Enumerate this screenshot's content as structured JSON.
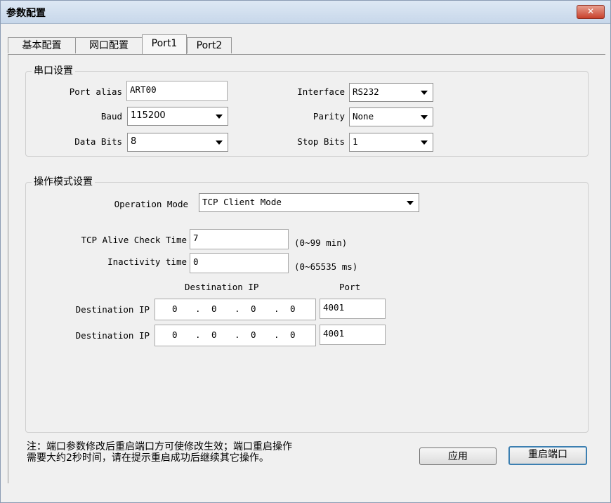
{
  "window": {
    "title": "参数配置",
    "close_symbol": "✕"
  },
  "tabs": [
    "基本配置",
    "网口配置",
    "Port1",
    "Port2"
  ],
  "serial": {
    "legend": "串口设置",
    "port_alias_label": "Port alias",
    "port_alias_value": "ART00",
    "interface_label": "Interface",
    "interface_value": "RS232",
    "baud_label": "Baud",
    "baud_value": "115200",
    "parity_label": "Parity",
    "parity_value": "None",
    "data_bits_label": "Data Bits",
    "data_bits_value": "8",
    "stop_bits_label": "Stop Bits",
    "stop_bits_value": "1"
  },
  "op": {
    "legend": "操作模式设置",
    "mode_label": "Operation Mode",
    "mode_value": "TCP Client Mode",
    "alive_label": "TCP Alive Check Time",
    "alive_value": "7",
    "alive_unit": "(0~99 min)",
    "inactivity_label": "Inactivity time",
    "inactivity_value": "0",
    "inactivity_unit": "(0~65535 ms)",
    "dest_ip_header": "Destination IP",
    "port_header": "Port",
    "rows": [
      {
        "label": "Destination IP",
        "octets": [
          "0",
          "0",
          "0",
          "0"
        ],
        "port": "4001"
      },
      {
        "label": "Destination IP",
        "octets": [
          "0",
          "0",
          "0",
          "0"
        ],
        "port": "4001"
      }
    ]
  },
  "note_lines": [
    "注：端口参数修改后重启端口方可使修改生效；端口重启操作",
    "需要大约2秒时间，请在提示重启成功后继续其它操作。"
  ],
  "buttons": {
    "apply": "应用",
    "restart": "重启端口"
  }
}
